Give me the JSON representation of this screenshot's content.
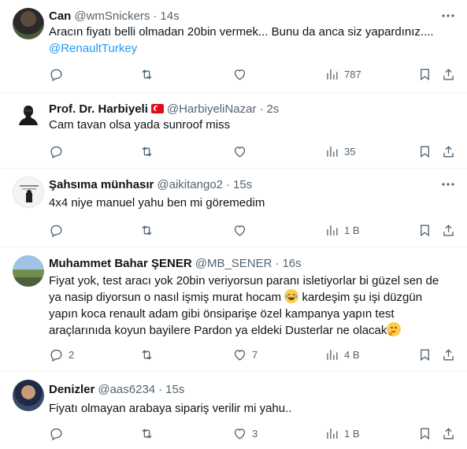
{
  "tweets": [
    {
      "name": "Can",
      "handle": "@wmSnickers",
      "sep": "·",
      "time": "14s",
      "text1": "Aracın fiyatı belli olmadan 20bin vermek... Bunu da anca siz yapardınız....",
      "mention": "@RenaultTurkey",
      "replies": "",
      "retweets": "",
      "likes": "",
      "views": "787"
    },
    {
      "name": "Prof. Dr. Harbiyeli",
      "handle": "@HarbiyeliNazar",
      "sep": "·",
      "time": "2s",
      "text1": "Cam tavan olsa yada sunroof miss",
      "replies": "",
      "retweets": "",
      "likes": "",
      "views": "35"
    },
    {
      "name": "Şahsıma münhasır",
      "handle": "@aikitango2",
      "sep": "·",
      "time": "15s",
      "text1": "4x4 niye manuel yahu ben mi göremedim",
      "replies": "",
      "retweets": "",
      "likes": "",
      "views": "1 B"
    },
    {
      "name": "Muhammet Bahar ŞENER",
      "handle": "@MB_SENER",
      "sep": "·",
      "time": "16s",
      "line1": "Fiyat yok, test aracı yok 20bin veriyorsun paranı isletiyorlar bi güzel sen de",
      "line2a": "ya nasip diyorsun o nasıl işmiş murat hocam",
      "line2b": "kardeşim şu işi düzgün",
      "line3": "yapın koca renault adam gibi önsiparişe özel kampanya yapın test",
      "line4": "araçlarınıda koyun bayilere Pardon ya eldeki Dusterlar ne olacak",
      "replies": "2",
      "retweets": "",
      "likes": "7",
      "views": "4 B"
    },
    {
      "name": "Denizler",
      "handle": "@aas6234",
      "sep": "·",
      "time": "15s",
      "text1": "Fiyatı olmayan arabaya sipariş verilir mi yahu..",
      "replies": "",
      "retweets": "",
      "likes": "3",
      "views": "1 B"
    }
  ]
}
